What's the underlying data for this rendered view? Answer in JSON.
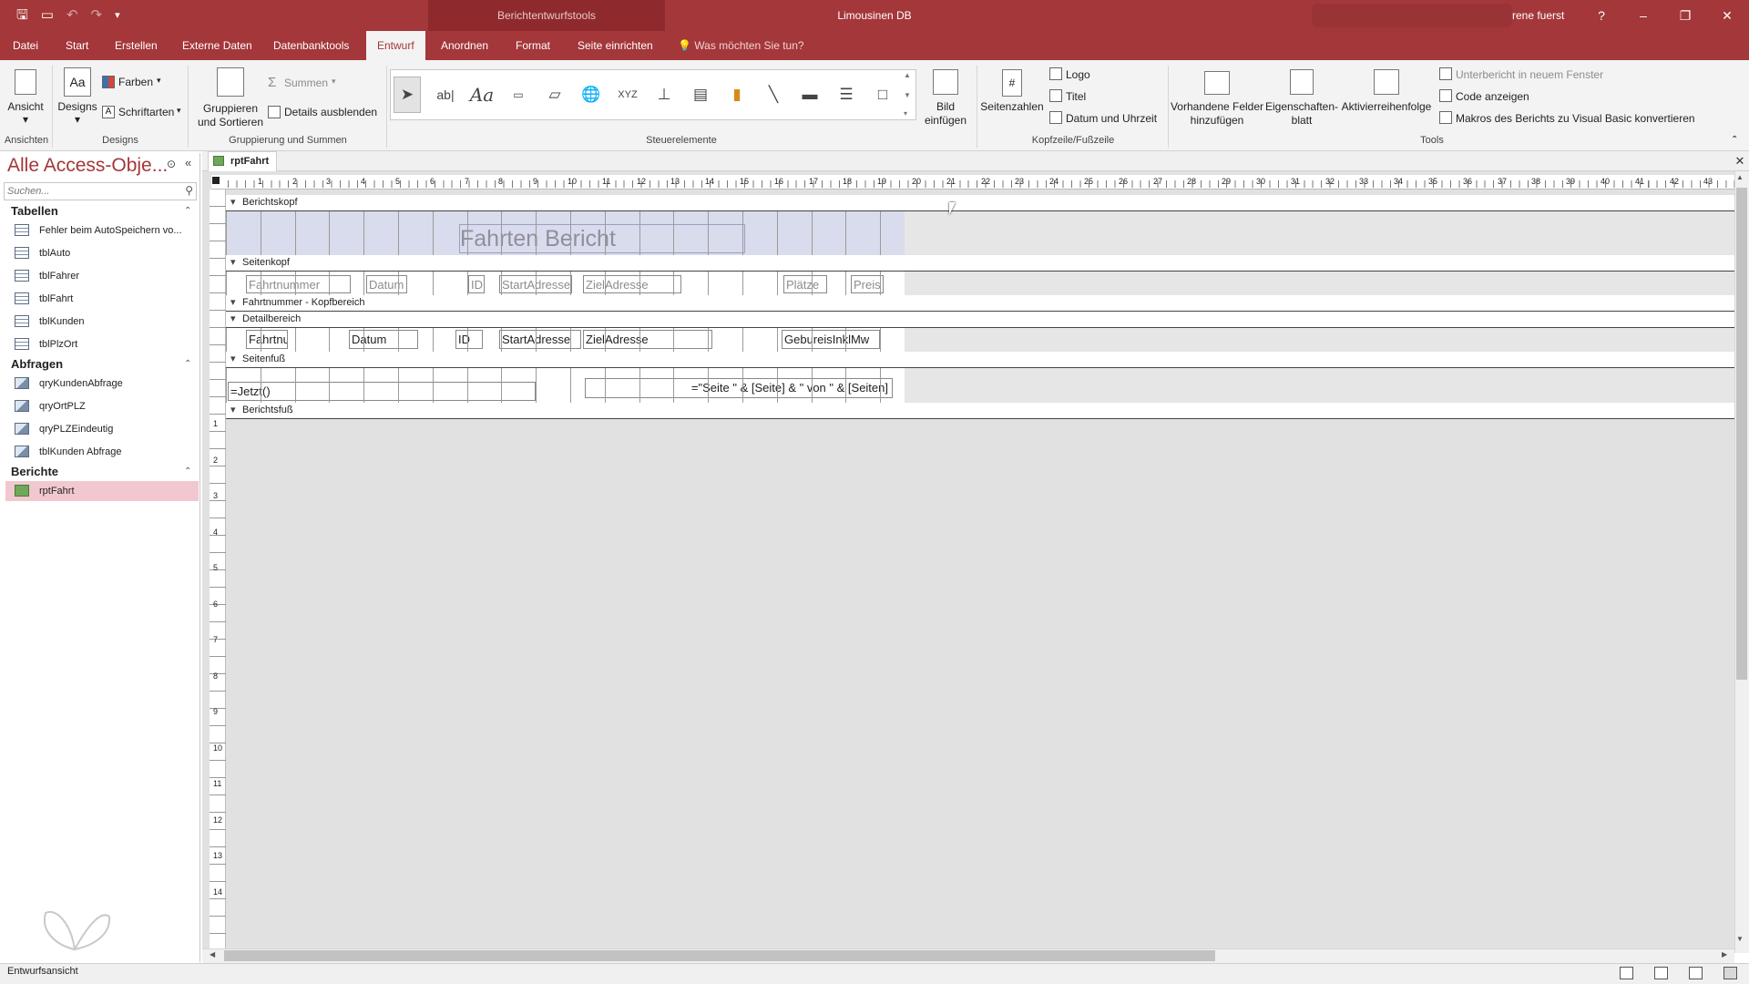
{
  "titlebar": {
    "context_title": "Berichtentwurfstools",
    "app_title": "Limousinen DB",
    "user": "rene fuerst",
    "help": "?",
    "minimize": "–",
    "restore": "❐",
    "close": "✕"
  },
  "tabs": [
    "Datei",
    "Start",
    "Erstellen",
    "Externe Daten",
    "Datenbanktools",
    "Entwurf",
    "Anordnen",
    "Format",
    "Seite einrichten"
  ],
  "active_tab": "Entwurf",
  "tell_me": "Was möchten Sie tun?",
  "ribbon": {
    "ansicht": "Ansicht",
    "designs": "Designs",
    "farben": "Farben",
    "schriftarten": "Schriftarten",
    "gruppieren": "Gruppieren und Sortieren",
    "summen": "Summen",
    "details": "Details ausblenden",
    "bild": "Bild einfügen",
    "seitenzahlen": "Seitenzahlen",
    "logo": "Logo",
    "titel": "Titel",
    "datum_uhrzeit": "Datum und Uhrzeit",
    "vorhandene": "Vorhandene Felder hinzufügen",
    "eigenschaften": "Eigenschaften-blatt",
    "aktivierung": "Aktivierreihenfolge",
    "unterbericht": "Unterbericht in neuem Fenster",
    "code": "Code anzeigen",
    "makros": "Makros des Berichts zu Visual Basic konvertieren",
    "groups": {
      "ansichten": "Ansichten",
      "designs": "Designs",
      "gruppierung": "Gruppierung und Summen",
      "steuerelemente": "Steuerelemente",
      "kopfzeile": "Kopfzeile/Fußzeile",
      "tools": "Tools"
    }
  },
  "nav": {
    "title": "Alle Access-Obje...",
    "search_placeholder": "Suchen...",
    "tabellen_header": "Tabellen",
    "tabellen": [
      "Fehler beim AutoSpeichern vo...",
      "tblAuto",
      "tblFahrer",
      "tblFahrt",
      "tblKunden",
      "tblPlzOrt"
    ],
    "abfragen_header": "Abfragen",
    "abfragen": [
      "qryKundenAbfrage",
      "qryOrtPLZ",
      "qryPLZEindeutig",
      "tblKunden Abfrage"
    ],
    "berichte_header": "Berichte",
    "berichte": [
      "rptFahrt"
    ]
  },
  "document": {
    "tab_title": "rptFahrt",
    "sections": {
      "berichtskopf": "Berichtskopf",
      "seitenkopf": "Seitenkopf",
      "fahrtnummer_kopf": "Fahrtnummer - Kopfbereich",
      "detailbereich": "Detailbereich",
      "seitenfuss": "Seitenfuß",
      "berichtsfuss": "Berichtsfuß"
    },
    "report_title": "Fahrten Bericht",
    "header_labels": [
      "Fahrtnummer",
      "Datum",
      "ID",
      "StartAdresse",
      "ZielAdresse",
      "Plätze",
      "Preis"
    ],
    "detail_fields": [
      "Fahrtnu",
      "Datum",
      "ID",
      "StartAdresse",
      "ZielAdresse",
      "GebureisInklMw"
    ],
    "footer_now": "=Jetzt()",
    "footer_page": "=\"Seite \" & [Seite] & \" von \" & [Seiten]"
  },
  "status": "Entwurfsansicht"
}
